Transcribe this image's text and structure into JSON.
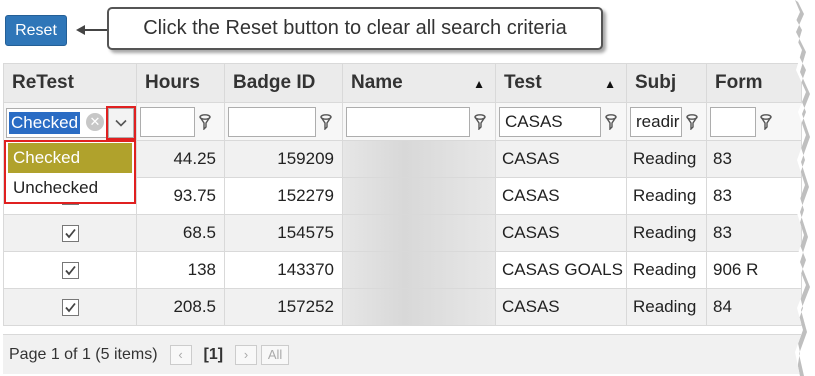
{
  "toolbar": {
    "reset_label": "Reset"
  },
  "callout": {
    "text": "Click the Reset button to clear all search criteria"
  },
  "columns": [
    {
      "label": "ReTest"
    },
    {
      "label": "Hours"
    },
    {
      "label": "Badge ID"
    },
    {
      "label": "Name"
    },
    {
      "label": "Test"
    },
    {
      "label": "Subj"
    },
    {
      "label": "Form"
    }
  ],
  "filters": {
    "retest_value": "Checked",
    "test_value": "CASAS",
    "subj_value": "readir"
  },
  "dropdown": {
    "options": [
      "Checked",
      "Unchecked"
    ],
    "highlighted": "Checked"
  },
  "rows": [
    {
      "retest": true,
      "hours": "44.25",
      "badge": "159209",
      "test": "CASAS",
      "subj": "Reading",
      "form": "83"
    },
    {
      "retest": true,
      "hours": "93.75",
      "badge": "152279",
      "test": "CASAS",
      "subj": "Reading",
      "form": "83"
    },
    {
      "retest": true,
      "hours": "68.5",
      "badge": "154575",
      "test": "CASAS",
      "subj": "Reading",
      "form": "83"
    },
    {
      "retest": true,
      "hours": "138",
      "badge": "143370",
      "test": "CASAS GOALS",
      "subj": "Reading",
      "form": "906 R"
    },
    {
      "retest": true,
      "hours": "208.5",
      "badge": "157252",
      "test": "CASAS",
      "subj": "Reading",
      "form": "84"
    }
  ],
  "pager": {
    "summary": "Page 1 of 1 (5 items)",
    "current_page": "[1]",
    "all_label": "All"
  },
  "colors": {
    "reset_button": "#2f76b8",
    "highlight_option": "#b0a22c",
    "annotation_red": "#e02020",
    "selection_blue": "#2a6cc4"
  }
}
